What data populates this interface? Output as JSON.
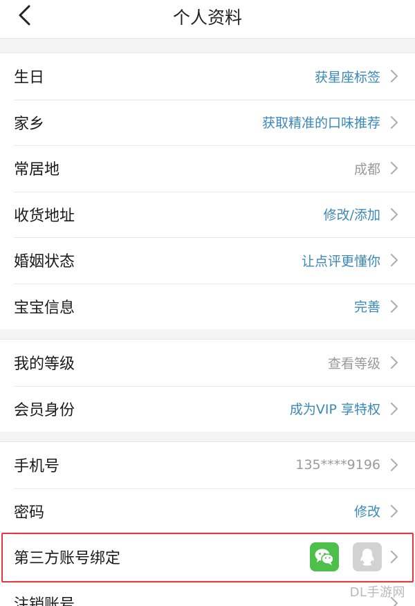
{
  "header": {
    "title": "个人资料"
  },
  "groups": [
    {
      "rows": [
        {
          "label": "生日",
          "value": "获星座标签"
        },
        {
          "label": "家乡",
          "value": "获取精准的口味推荐"
        },
        {
          "label": "常居地",
          "value": "成都"
        },
        {
          "label": "收货地址",
          "value": "修改/添加"
        },
        {
          "label": "婚姻状态",
          "value": "让点评更懂你"
        },
        {
          "label": "宝宝信息",
          "value": "完善"
        }
      ]
    },
    {
      "rows": [
        {
          "label": "我的等级",
          "value": "查看等级"
        },
        {
          "label": "会员身份",
          "value": "成为VIP 享特权"
        }
      ]
    },
    {
      "rows": [
        {
          "label": "手机号",
          "value": "135****9196"
        },
        {
          "label": "密码",
          "value": "修改"
        },
        {
          "label": "第三方账号绑定"
        },
        {
          "label": "注销账号"
        }
      ]
    }
  ],
  "colors": {
    "link": "#3a88b8",
    "muted": "#9a9a9a",
    "wechat": "#4cc04a",
    "qq_inactive": "#d2d2d2",
    "highlight": "#e0383e"
  },
  "icons": {
    "wechat": "wechat-icon",
    "qq": "qq-icon",
    "back": "chevron-left-icon",
    "row_arrow": "chevron-right-icon"
  },
  "watermark": "DL手游网"
}
